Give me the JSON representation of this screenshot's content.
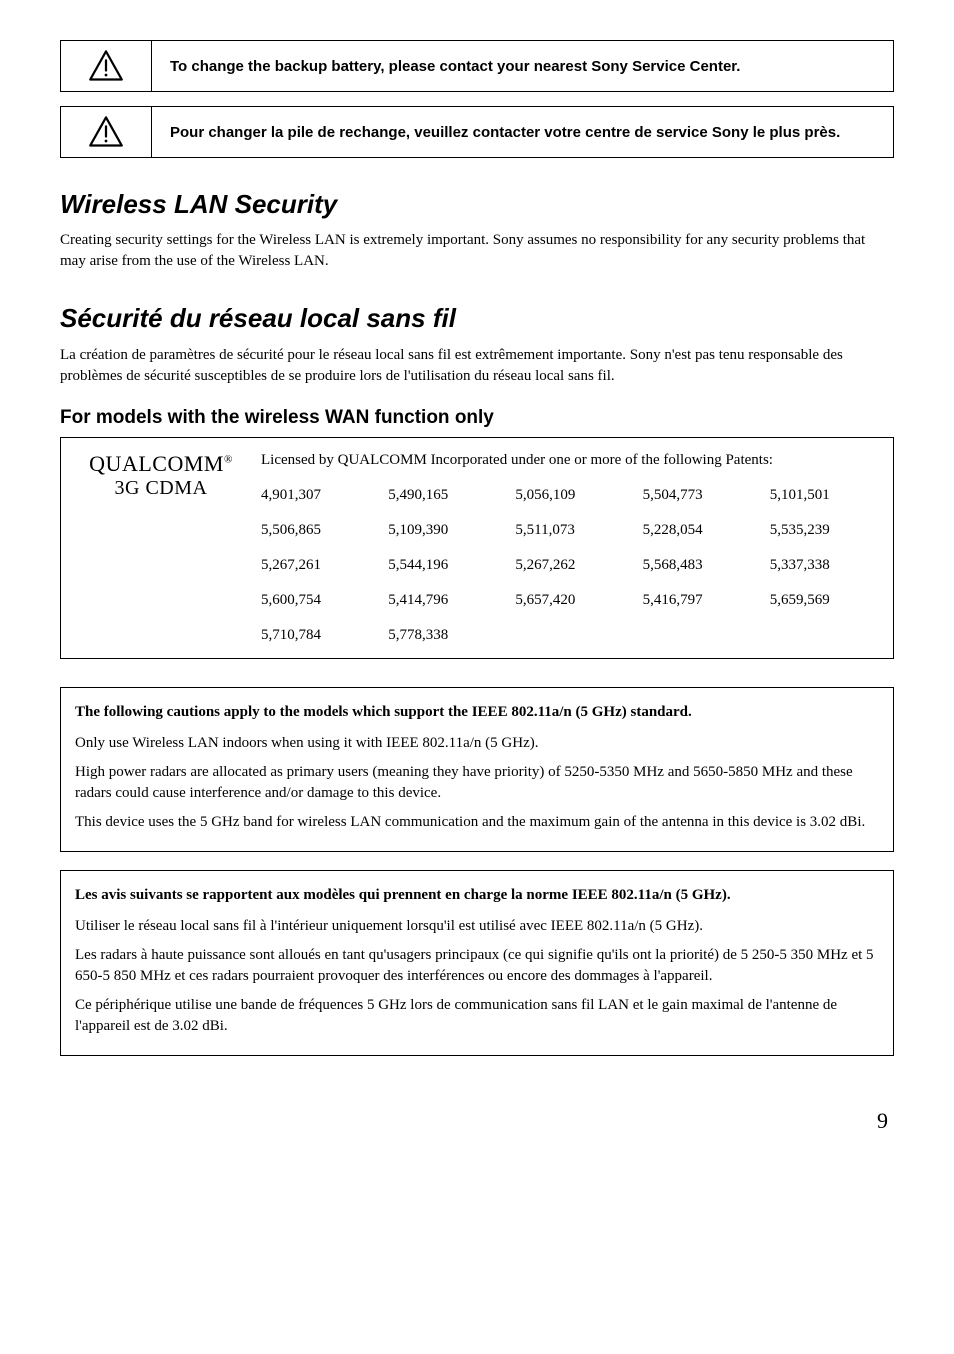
{
  "warning1": {
    "text": "To change the backup battery, please contact your nearest Sony Service Center."
  },
  "warning2": {
    "text": "Pour changer la pile de rechange, veuillez contacter votre centre de service Sony le plus près."
  },
  "section1": {
    "heading": "Wireless LAN Security",
    "body": "Creating security settings for the Wireless LAN is extremely important. Sony assumes no responsibility for any security problems that may arise from the use of the Wireless LAN."
  },
  "section2": {
    "heading": "Sécurité du réseau local sans fil",
    "body": "La création de paramètres de sécurité pour le réseau local sans fil est extrêmement importante. Sony n'est pas tenu responsable des problèmes de sécurité susceptibles de se produire lors de l'utilisation du réseau local sans fil."
  },
  "subheading": "For models with the wireless WAN function only",
  "qualcomm": {
    "top": "QUALCOMM",
    "reg": "®",
    "bottom": "3G CDMA",
    "intro": "Licensed by QUALCOMM Incorporated under one or more of the following Patents:",
    "patents": [
      "4,901,307",
      "5,490,165",
      "5,056,109",
      "5,504,773",
      "5,101,501",
      "5,506,865",
      "5,109,390",
      "5,511,073",
      "5,228,054",
      "5,535,239",
      "5,267,261",
      "5,544,196",
      "5,267,262",
      "5,568,483",
      "5,337,338",
      "5,600,754",
      "5,414,796",
      "5,657,420",
      "5,416,797",
      "5,659,569",
      "5,710,784",
      "5,778,338"
    ]
  },
  "caution_en": {
    "lead": "The following cautions apply to the models which support the IEEE 802.11a/n (5 GHz) standard.",
    "p1": "Only use Wireless LAN indoors when using it with IEEE 802.11a/n (5 GHz).",
    "p2": "High power radars are allocated as primary users (meaning they have priority) of 5250-5350 MHz and 5650-5850 MHz and these radars could cause interference and/or damage to this device.",
    "p3": "This device uses the 5 GHz band for wireless LAN communication and the maximum gain of the antenna in this device is 3.02 dBi."
  },
  "caution_fr": {
    "lead": "Les avis suivants se rapportent aux modèles qui prennent en charge la norme IEEE 802.11a/n (5 GHz).",
    "p1": "Utiliser le réseau local sans fil à l'intérieur uniquement lorsqu'il est utilisé avec IEEE 802.11a/n (5 GHz).",
    "p2": "Les radars à haute puissance sont alloués en tant qu'usagers principaux (ce qui signifie qu'ils ont la priorité) de 5 250-5 350 MHz et 5 650-5 850 MHz et ces radars pourraient provoquer des interférences ou encore des dommages à l'appareil.",
    "p3": "Ce périphérique utilise une bande de fréquences 5 GHz lors de communication sans fil LAN et le gain maximal de l'antenne de l'appareil est de 3.02 dBi."
  },
  "page_number": "9"
}
